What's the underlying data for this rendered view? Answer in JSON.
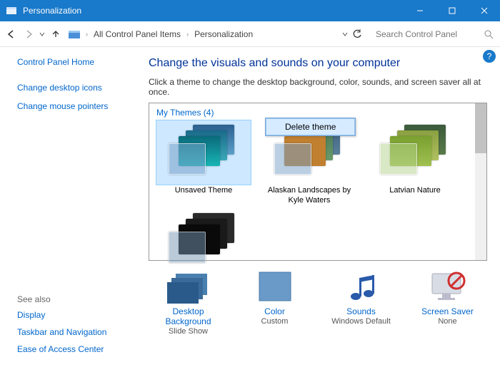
{
  "window": {
    "title": "Personalization"
  },
  "breadcrumb": {
    "root": "All Control Panel Items",
    "current": "Personalization"
  },
  "search": {
    "placeholder": "Search Control Panel"
  },
  "sidebar": {
    "home": "Control Panel Home",
    "links": [
      "Change desktop icons",
      "Change mouse pointers"
    ],
    "seealso_label": "See also",
    "seealso": [
      "Display",
      "Taskbar and Navigation",
      "Ease of Access Center"
    ]
  },
  "main": {
    "heading": "Change the visuals and sounds on your computer",
    "subtitle": "Click a theme to change the desktop background, color, sounds, and screen saver all at once."
  },
  "themes": {
    "header": "My Themes (4)",
    "items": [
      {
        "label": "Unsaved Theme"
      },
      {
        "label": "Alaskan Landscapes by Kyle Waters"
      },
      {
        "label": "Latvian Nature"
      },
      {
        "label": ""
      }
    ]
  },
  "context_menu": {
    "item": "Delete theme"
  },
  "bottom": [
    {
      "label1": "Desktop Background",
      "label2": "Slide Show"
    },
    {
      "label1": "Color",
      "label2": "Custom"
    },
    {
      "label1": "Sounds",
      "label2": "Windows Default"
    },
    {
      "label1": "Screen Saver",
      "label2": "None"
    }
  ]
}
